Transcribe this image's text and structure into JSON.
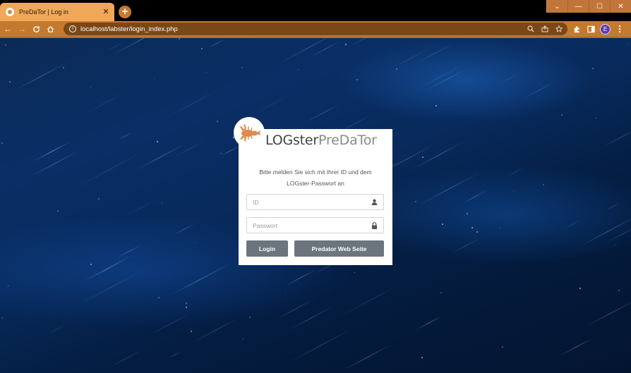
{
  "browser": {
    "tab_title": "PreDaTor | Log in",
    "tab_close": "✕",
    "new_tab": "+",
    "url": "localhost/labster/login_index.php",
    "profile_initial": "E",
    "window_controls": [
      "⌄",
      "—",
      "☐",
      "✕"
    ],
    "nav": {
      "back": "←",
      "forward": "→",
      "reload": "C",
      "home": "⌂"
    },
    "omnibox_icons": [
      "search-icon",
      "share-icon",
      "star-icon"
    ],
    "toolbar_icons": [
      "extensions-icon",
      "sidepanel-icon",
      "menu-icon"
    ],
    "theme_color": "#c47a2e"
  },
  "login": {
    "brand_bold": "LOGster",
    "brand_light": "PreDaTor",
    "prompt_line1": "Bitte melden Sie sich mit Ihrer ID und dem",
    "prompt_line2": "LOGster-Passwort an",
    "id_placeholder": "ID",
    "password_placeholder": "Passwort",
    "login_button": "Login",
    "web_button": "Predator Web Seite",
    "button_color": "#6c757d",
    "logo_color": "#e08a4c"
  }
}
